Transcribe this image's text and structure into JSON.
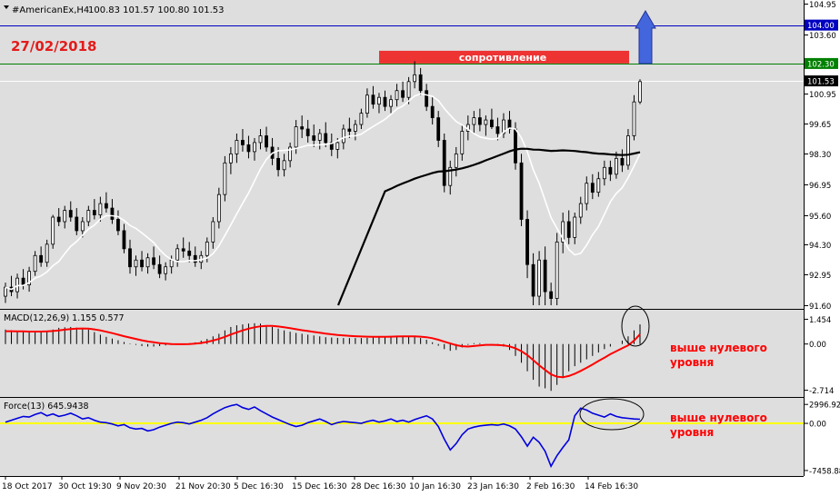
{
  "chart_data": {
    "type": "candlestick",
    "header": {
      "symbol_label": "#AmericanEx,H4",
      "ohlc": "100.83 101.57 100.80 101.53"
    },
    "date_annotation": "27/02/2018",
    "resistance_label": "сопротивление",
    "price_axis": {
      "ticks": [
        "104.95",
        "103.60",
        "102.30",
        "100.95",
        "99.65",
        "98.30",
        "96.95",
        "95.60",
        "94.30",
        "92.95",
        "91.60"
      ],
      "tick_values": [
        104.95,
        103.6,
        102.3,
        100.95,
        99.65,
        98.3,
        96.95,
        95.6,
        94.3,
        92.95,
        91.6
      ],
      "range": [
        91.6,
        104.95
      ]
    },
    "levels": [
      {
        "name": "target",
        "value": 104.0,
        "label": "104.00",
        "color": "#0000c0"
      },
      {
        "name": "resistance",
        "value": 102.3,
        "label": "102.30",
        "color": "#008000"
      },
      {
        "name": "current",
        "value": 101.53,
        "label": "101.53",
        "color": "#000000"
      }
    ],
    "time_axis": [
      "18 Oct 2017",
      "30 Oct 19:30",
      "9 Nov 20:30",
      "21 Nov 20:30",
      "5 Dec 16:30",
      "15 Dec 16:30",
      "28 Dec 16:30",
      "10 Jan 16:30",
      "23 Jan 16:30",
      "2 Feb 16:30",
      "14 Feb 16:30"
    ],
    "candles": [
      [
        92.0,
        92.6,
        91.7,
        92.4
      ],
      [
        92.4,
        92.9,
        92.0,
        92.2
      ],
      [
        92.2,
        93.0,
        91.9,
        92.8
      ],
      [
        92.8,
        93.2,
        92.3,
        92.5
      ],
      [
        92.5,
        93.3,
        92.2,
        93.1
      ],
      [
        93.1,
        94.0,
        92.9,
        93.8
      ],
      [
        93.8,
        94.2,
        93.3,
        93.5
      ],
      [
        93.5,
        94.5,
        93.3,
        94.3
      ],
      [
        94.3,
        95.6,
        94.1,
        95.5
      ],
      [
        95.5,
        95.9,
        95.1,
        95.3
      ],
      [
        95.3,
        96.0,
        95.0,
        95.8
      ],
      [
        95.8,
        96.2,
        95.3,
        95.5
      ],
      [
        95.5,
        95.9,
        94.7,
        94.9
      ],
      [
        94.9,
        95.5,
        94.6,
        95.3
      ],
      [
        95.3,
        96.0,
        95.1,
        95.8
      ],
      [
        95.8,
        96.3,
        95.4,
        95.6
      ],
      [
        95.6,
        96.4,
        95.3,
        96.1
      ],
      [
        96.1,
        96.6,
        95.7,
        95.9
      ],
      [
        95.9,
        96.3,
        95.2,
        95.4
      ],
      [
        95.4,
        95.8,
        94.7,
        94.9
      ],
      [
        94.9,
        95.2,
        93.9,
        94.1
      ],
      [
        94.1,
        94.5,
        93.0,
        93.3
      ],
      [
        93.3,
        93.8,
        92.9,
        93.6
      ],
      [
        93.6,
        94.0,
        93.1,
        93.3
      ],
      [
        93.3,
        93.9,
        93.0,
        93.7
      ],
      [
        93.7,
        94.2,
        93.2,
        93.4
      ],
      [
        93.4,
        93.8,
        92.8,
        93.0
      ],
      [
        93.0,
        93.5,
        92.7,
        93.3
      ],
      [
        93.3,
        93.8,
        93.0,
        93.6
      ],
      [
        93.6,
        94.3,
        93.3,
        94.1
      ],
      [
        94.1,
        94.6,
        93.7,
        94.0
      ],
      [
        94.0,
        94.4,
        93.5,
        93.8
      ],
      [
        93.8,
        94.2,
        93.3,
        93.5
      ],
      [
        93.5,
        94.0,
        93.2,
        93.8
      ],
      [
        93.8,
        94.6,
        93.5,
        94.4
      ],
      [
        94.4,
        95.5,
        94.1,
        95.3
      ],
      [
        95.3,
        96.8,
        95.0,
        96.5
      ],
      [
        96.5,
        98.2,
        96.2,
        97.9
      ],
      [
        97.9,
        98.6,
        97.4,
        98.3
      ],
      [
        98.3,
        99.2,
        97.9,
        98.9
      ],
      [
        98.9,
        99.4,
        98.4,
        98.7
      ],
      [
        98.7,
        99.1,
        98.1,
        98.4
      ],
      [
        98.4,
        99.0,
        98.0,
        98.8
      ],
      [
        98.8,
        99.4,
        98.5,
        99.1
      ],
      [
        99.1,
        99.5,
        98.4,
        98.6
      ],
      [
        98.6,
        99.0,
        97.8,
        98.1
      ],
      [
        98.1,
        98.6,
        97.3,
        97.6
      ],
      [
        97.6,
        98.3,
        97.3,
        98.0
      ],
      [
        98.0,
        98.8,
        97.7,
        98.6
      ],
      [
        98.6,
        99.8,
        98.3,
        99.5
      ],
      [
        99.5,
        100.0,
        99.0,
        99.4
      ],
      [
        99.4,
        99.8,
        98.8,
        99.1
      ],
      [
        99.1,
        99.6,
        98.6,
        98.9
      ],
      [
        98.9,
        99.4,
        98.5,
        99.2
      ],
      [
        99.2,
        99.7,
        98.6,
        98.8
      ],
      [
        98.8,
        99.2,
        98.2,
        98.5
      ],
      [
        98.5,
        99.0,
        98.1,
        98.8
      ],
      [
        98.8,
        99.6,
        98.5,
        99.4
      ],
      [
        99.4,
        99.9,
        99.0,
        99.3
      ],
      [
        99.3,
        99.8,
        98.9,
        99.6
      ],
      [
        99.6,
        100.3,
        99.4,
        100.1
      ],
      [
        100.1,
        101.2,
        99.9,
        100.9
      ],
      [
        100.9,
        101.3,
        100.3,
        100.5
      ],
      [
        100.5,
        101.0,
        100.1,
        100.8
      ],
      [
        100.8,
        101.1,
        100.2,
        100.4
      ],
      [
        100.4,
        100.9,
        100.1,
        100.7
      ],
      [
        100.7,
        101.4,
        100.4,
        101.1
      ],
      [
        101.1,
        101.5,
        100.6,
        100.8
      ],
      [
        100.8,
        101.7,
        100.5,
        101.5
      ],
      [
        101.5,
        102.4,
        101.2,
        101.8
      ],
      [
        101.8,
        102.1,
        100.9,
        101.1
      ],
      [
        101.1,
        101.4,
        100.2,
        100.4
      ],
      [
        100.4,
        100.8,
        99.6,
        99.9
      ],
      [
        99.9,
        100.2,
        98.6,
        98.9
      ],
      [
        98.9,
        99.2,
        96.6,
        96.9
      ],
      [
        96.9,
        98.0,
        96.5,
        97.7
      ],
      [
        97.7,
        98.6,
        97.3,
        98.3
      ],
      [
        98.3,
        99.6,
        98.0,
        99.3
      ],
      [
        99.3,
        100.0,
        98.9,
        99.6
      ],
      [
        99.6,
        100.2,
        99.2,
        99.9
      ],
      [
        99.9,
        100.3,
        99.3,
        99.6
      ],
      [
        99.6,
        100.0,
        99.1,
        99.8
      ],
      [
        99.8,
        100.3,
        99.4,
        99.5
      ],
      [
        99.5,
        99.9,
        98.9,
        99.2
      ],
      [
        99.2,
        100.1,
        99.0,
        99.8
      ],
      [
        99.8,
        100.2,
        99.2,
        99.4
      ],
      [
        99.4,
        99.7,
        97.6,
        97.9
      ],
      [
        97.9,
        98.3,
        95.1,
        95.4
      ],
      [
        95.4,
        95.8,
        92.8,
        93.4
      ],
      [
        93.4,
        93.9,
        91.6,
        92.0
      ],
      [
        92.0,
        94.0,
        91.6,
        93.6
      ],
      [
        93.6,
        94.2,
        91.6,
        92.2
      ],
      [
        92.2,
        92.6,
        91.6,
        91.9
      ],
      [
        91.9,
        94.8,
        91.6,
        94.4
      ],
      [
        94.4,
        95.7,
        93.9,
        95.3
      ],
      [
        95.3,
        95.8,
        94.3,
        94.6
      ],
      [
        94.6,
        95.7,
        94.3,
        95.5
      ],
      [
        95.5,
        96.4,
        95.2,
        96.1
      ],
      [
        96.1,
        97.3,
        95.8,
        97.0
      ],
      [
        97.0,
        97.4,
        96.3,
        96.6
      ],
      [
        96.6,
        97.5,
        96.4,
        97.2
      ],
      [
        97.2,
        98.0,
        96.9,
        97.7
      ],
      [
        97.7,
        98.0,
        97.1,
        97.4
      ],
      [
        97.4,
        98.4,
        97.2,
        98.1
      ],
      [
        98.1,
        98.5,
        97.5,
        97.8
      ],
      [
        97.8,
        99.4,
        97.6,
        99.1
      ],
      [
        99.1,
        100.9,
        98.9,
        100.6
      ],
      [
        100.6,
        101.6,
        100.5,
        101.5
      ]
    ],
    "macd": {
      "name": "MACD(12,26,9) 1.155 0.577",
      "ticks": [
        "1.454",
        "0.00",
        "-2.714"
      ],
      "tick_values": [
        1.454,
        0.0,
        -2.714
      ],
      "range": [
        -2.95,
        1.85
      ],
      "histogram": [
        0.85,
        0.8,
        0.75,
        0.72,
        0.7,
        0.72,
        0.74,
        0.78,
        0.85,
        0.95,
        0.98,
        1.0,
        0.96,
        0.9,
        0.85,
        0.7,
        0.55,
        0.42,
        0.32,
        0.22,
        0.12,
        0.03,
        -0.05,
        -0.12,
        -0.15,
        -0.15,
        -0.12,
        -0.08,
        -0.05,
        -0.02,
        0.0,
        0.05,
        0.1,
        0.2,
        0.3,
        0.45,
        0.6,
        0.8,
        1.0,
        1.1,
        1.15,
        1.2,
        1.22,
        1.2,
        1.1,
        1.0,
        0.9,
        0.8,
        0.72,
        0.65,
        0.6,
        0.55,
        0.5,
        0.45,
        0.4,
        0.38,
        0.36,
        0.35,
        0.35,
        0.35,
        0.35,
        0.36,
        0.38,
        0.4,
        0.42,
        0.45,
        0.48,
        0.48,
        0.46,
        0.42,
        0.35,
        0.25,
        0.1,
        -0.1,
        -0.3,
        -0.4,
        -0.35,
        -0.2,
        -0.05,
        0.05,
        0.05,
        0.0,
        -0.05,
        -0.1,
        -0.15,
        -0.35,
        -0.7,
        -1.1,
        -1.6,
        -2.1,
        -2.5,
        -2.6,
        -2.75,
        -2.4,
        -2.0,
        -1.6,
        -1.3,
        -1.1,
        -0.9,
        -0.7,
        -0.5,
        -0.3,
        -0.15,
        0.0,
        0.2,
        0.45,
        0.8,
        1.15
      ],
      "signal": [
        0.75,
        0.75,
        0.74,
        0.74,
        0.73,
        0.73,
        0.73,
        0.74,
        0.76,
        0.8,
        0.84,
        0.88,
        0.9,
        0.91,
        0.9,
        0.86,
        0.8,
        0.72,
        0.64,
        0.55,
        0.46,
        0.38,
        0.3,
        0.22,
        0.15,
        0.1,
        0.05,
        0.02,
        0.0,
        -0.01,
        -0.01,
        0.0,
        0.02,
        0.06,
        0.12,
        0.2,
        0.3,
        0.42,
        0.56,
        0.68,
        0.8,
        0.9,
        0.98,
        1.04,
        1.06,
        1.06,
        1.03,
        0.98,
        0.93,
        0.87,
        0.81,
        0.76,
        0.71,
        0.66,
        0.61,
        0.57,
        0.53,
        0.5,
        0.48,
        0.46,
        0.44,
        0.43,
        0.42,
        0.42,
        0.42,
        0.43,
        0.44,
        0.45,
        0.45,
        0.45,
        0.43,
        0.4,
        0.34,
        0.25,
        0.14,
        0.03,
        -0.07,
        -0.13,
        -0.15,
        -0.12,
        -0.08,
        -0.05,
        -0.05,
        -0.06,
        -0.08,
        -0.14,
        -0.25,
        -0.42,
        -0.65,
        -0.95,
        -1.25,
        -1.52,
        -1.78,
        -1.92,
        -1.95,
        -1.88,
        -1.75,
        -1.58,
        -1.4,
        -1.2,
        -1.0,
        -0.8,
        -0.6,
        -0.42,
        -0.25,
        -0.08,
        0.2,
        0.577
      ]
    },
    "force": {
      "name": "Force(13) 645.9438",
      "ticks": [
        "2996.92",
        "0.00",
        "-7458.88"
      ],
      "tick_values": [
        2996.92,
        0.0,
        -7458.88
      ],
      "range": [
        -7900,
        3600
      ],
      "values": [
        200,
        500,
        800,
        1100,
        1000,
        1400,
        1700,
        1200,
        1500,
        1100,
        1300,
        1600,
        1200,
        700,
        900,
        500,
        200,
        100,
        -100,
        -400,
        -200,
        -700,
        -900,
        -800,
        -1200,
        -1000,
        -600,
        -300,
        0,
        200,
        100,
        -100,
        200,
        500,
        900,
        1500,
        2000,
        2500,
        2800,
        3000,
        2500,
        2200,
        2600,
        2000,
        1500,
        1000,
        600,
        200,
        -200,
        -500,
        -300,
        100,
        400,
        700,
        300,
        -200,
        100,
        300,
        200,
        100,
        0,
        300,
        500,
        200,
        400,
        700,
        300,
        500,
        200,
        600,
        900,
        1200,
        700,
        -500,
        -2500,
        -4200,
        -3200,
        -1800,
        -900,
        -600,
        -400,
        -300,
        -200,
        -300,
        -100,
        -400,
        -900,
        -2100,
        -3600,
        -2200,
        -3000,
        -4400,
        -6800,
        -5100,
        -3800,
        -2600,
        1200,
        2400,
        2100,
        1600,
        1300,
        1000,
        1500,
        1100,
        900,
        800,
        700,
        646
      ]
    },
    "legend_annotations": [
      "выше нулевого уровня",
      "выше нулевого уровня"
    ]
  },
  "colors": {
    "plot_bg": "#dedede",
    "up_body": "#ffffff",
    "down_body": "#000000",
    "ma_fast": "#ffffff",
    "ma_slow": "#000000",
    "macd_histogram": "#000000",
    "macd_signal": "#ff0000",
    "force_line": "#0000dd",
    "zero_line": "#ffff00",
    "resistance_zone": "#ee3333",
    "annotation_text": "#ff0000",
    "arrow_fill": "#4466dd"
  }
}
